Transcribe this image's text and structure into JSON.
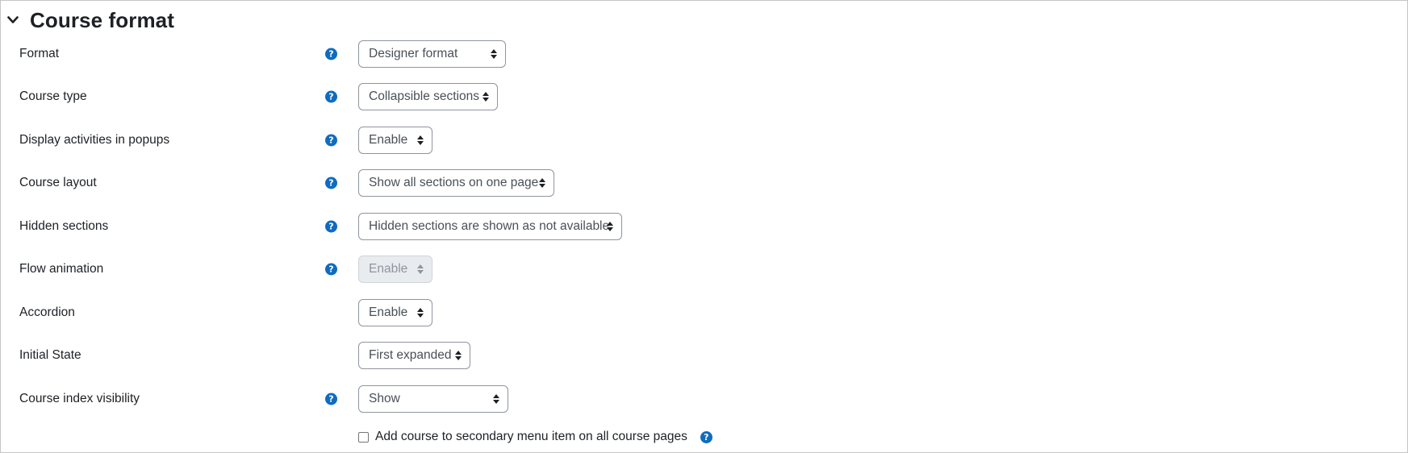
{
  "section": {
    "title": "Course format",
    "icon": "chevron-down-icon"
  },
  "help_icon": "question-mark-icon",
  "fields": [
    {
      "label": "Format",
      "value": "Designer format",
      "help": true
    },
    {
      "label": "Course type",
      "value": "Collapsible sections",
      "help": true
    },
    {
      "label": "Display activities in popups",
      "value": "Enable",
      "help": true
    },
    {
      "label": "Course layout",
      "value": "Show all sections on one page",
      "help": true
    },
    {
      "label": "Hidden sections",
      "value": "Hidden sections are shown as not available",
      "help": true
    },
    {
      "label": "Flow animation",
      "value": "Enable",
      "help": true,
      "disabled": true
    },
    {
      "label": "Accordion",
      "value": "Enable",
      "help": false
    },
    {
      "label": "Initial State",
      "value": "First expanded",
      "help": false
    },
    {
      "label": "Course index visibility",
      "value": "Show",
      "help": true
    }
  ],
  "checkbox": {
    "label": "Add course to secondary menu item on all course pages",
    "checked": false,
    "help": true
  },
  "colors": {
    "help_icon": "#0f6cbf",
    "text": "#1d2125",
    "border": "#8f959e"
  }
}
